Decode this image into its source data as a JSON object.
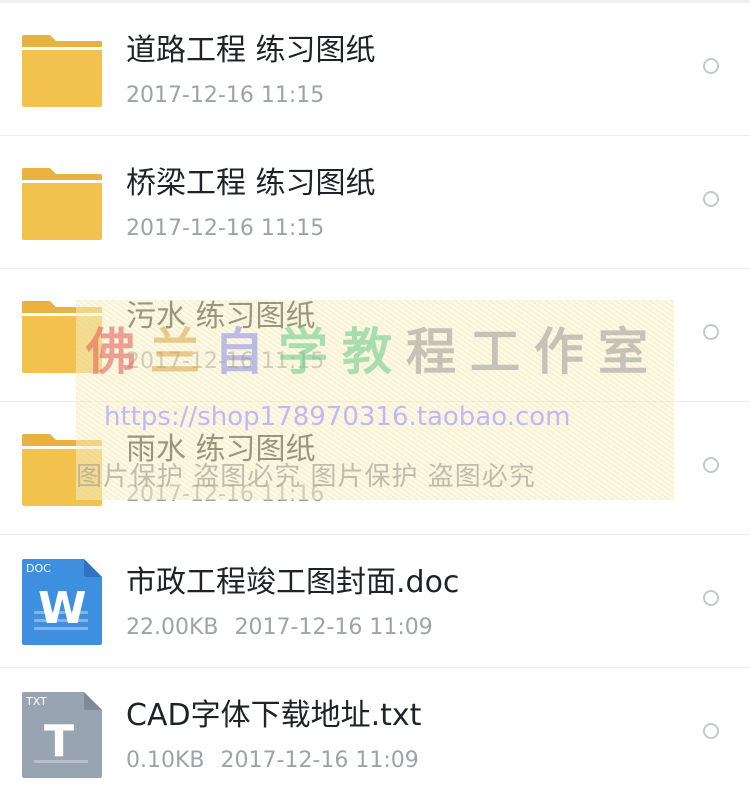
{
  "colors": {
    "folder": "#f2c14e",
    "folder_tab": "#e9b23f",
    "doc_blue": "#3f8fe0",
    "txt_gray": "#98a4b2",
    "name_text": "#1f2328",
    "meta_text": "#9ea3a8",
    "radio_border": "#c5c8cc"
  },
  "files": [
    {
      "icon": "folder-icon",
      "name": "道路工程 练习图纸",
      "size": "",
      "date": "2017-12-16  11:15"
    },
    {
      "icon": "folder-icon",
      "name": "桥梁工程 练习图纸",
      "size": "",
      "date": "2017-12-16  11:15"
    },
    {
      "icon": "folder-icon",
      "name": "污水 练习图纸",
      "size": "",
      "date": "2017-12-16  11:15"
    },
    {
      "icon": "folder-icon",
      "name": "雨水 练习图纸",
      "size": "",
      "date": "2017-12-16  11:16"
    },
    {
      "icon": "word-doc-icon",
      "badge": "DOC",
      "letter": "W",
      "name": "市政工程竣工图封面.doc",
      "size": "22.00KB",
      "date": "2017-12-16  11:09"
    },
    {
      "icon": "text-file-icon",
      "badge": "TXT",
      "letter": "T",
      "name": "CAD字体下载地址.txt",
      "size": "0.10KB",
      "date": "2017-12-16  11:09"
    }
  ],
  "watermark": {
    "title_chars": [
      "佛",
      "兰",
      "自",
      "学",
      "教",
      "程",
      "工",
      "作",
      "室"
    ],
    "url": "https://shop178970316.taobao.com",
    "protect": "图片保护  盗图必究  图片保护  盗图必究"
  }
}
